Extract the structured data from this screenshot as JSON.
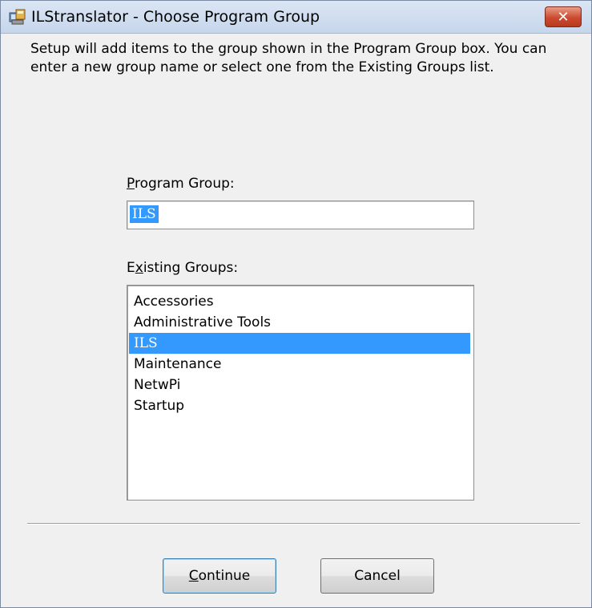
{
  "window": {
    "title": "ILStranslator - Choose Program Group",
    "close_label": "✕"
  },
  "intro_text": "Setup will add items to the group shown in the Program Group box. You can enter a new group name or select one from the Existing Groups list.",
  "program_group": {
    "label_mnemonic": "P",
    "label_rest": "rogram Group:",
    "value": "ILS"
  },
  "existing_groups": {
    "label_pre": "E",
    "label_mnemonic": "x",
    "label_rest": "isting Groups:",
    "items": [
      "Accessories",
      "Administrative Tools",
      "ILS",
      "Maintenance",
      "NetwPi",
      "Startup"
    ],
    "selected": "ILS"
  },
  "buttons": {
    "continue_mnemonic": "C",
    "continue_rest": "ontinue",
    "cancel": "Cancel"
  },
  "colors": {
    "selection": "#3399ff",
    "close_button": "#cc4a2e"
  }
}
